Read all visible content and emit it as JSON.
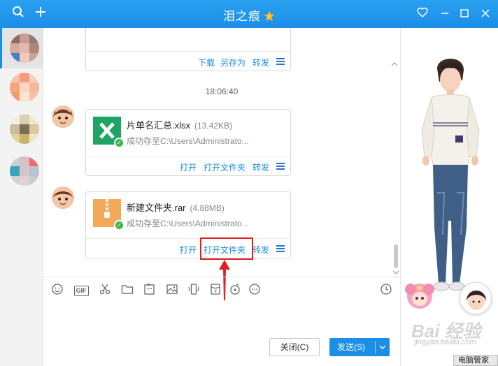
{
  "titlebar": {
    "title": "泪之痕",
    "search_icon": "search-icon",
    "add_icon": "plus-icon"
  },
  "chat": {
    "top_bubble_actions": [
      "下载",
      "另存为",
      "转发"
    ],
    "timestamp": "18:06:40",
    "files": [
      {
        "name": "片单名汇总.xlsx",
        "size": "(13.42KB)",
        "status": "成功存至C:\\Users\\Administrato...",
        "type": "excel",
        "actions": [
          "打开",
          "打开文件夹",
          "转发"
        ]
      },
      {
        "name": "新建文件夹.rar",
        "size": "(4.88MB)",
        "status": "成功存至C:\\Users\\Administrato...",
        "type": "archive",
        "actions": [
          "打开",
          "打开文件夹",
          "转发"
        ]
      }
    ]
  },
  "input_toolbar": {
    "gif_label": "GIF"
  },
  "buttons": {
    "close": "关闭(C)",
    "send": "发送(S)"
  },
  "watermark": {
    "brand": "Bai 经验",
    "url": "jingyan.baidu.com"
  },
  "taskbar": {
    "label": "电脑管家"
  },
  "colors": {
    "accent": "#1b8ee8",
    "link": "#1a8fe0",
    "excel_green": "#1fa463",
    "archive_orange": "#f2a95a",
    "highlight_red": "#e02020"
  }
}
